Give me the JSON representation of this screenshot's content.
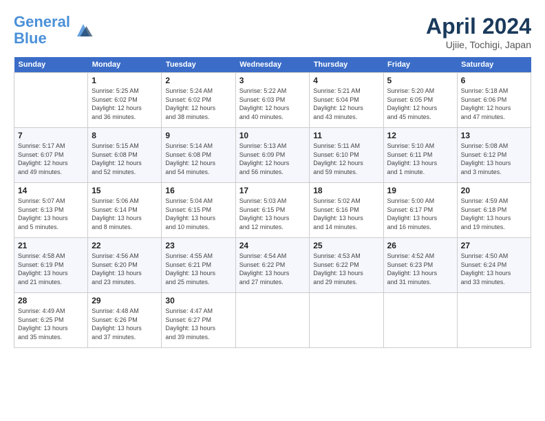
{
  "header": {
    "logo_line1": "General",
    "logo_line2": "Blue",
    "month_title": "April 2024",
    "location": "Ujiie, Tochigi, Japan"
  },
  "days_of_week": [
    "Sunday",
    "Monday",
    "Tuesday",
    "Wednesday",
    "Thursday",
    "Friday",
    "Saturday"
  ],
  "weeks": [
    [
      {
        "day": "",
        "info": ""
      },
      {
        "day": "1",
        "info": "Sunrise: 5:25 AM\nSunset: 6:02 PM\nDaylight: 12 hours\nand 36 minutes."
      },
      {
        "day": "2",
        "info": "Sunrise: 5:24 AM\nSunset: 6:02 PM\nDaylight: 12 hours\nand 38 minutes."
      },
      {
        "day": "3",
        "info": "Sunrise: 5:22 AM\nSunset: 6:03 PM\nDaylight: 12 hours\nand 40 minutes."
      },
      {
        "day": "4",
        "info": "Sunrise: 5:21 AM\nSunset: 6:04 PM\nDaylight: 12 hours\nand 43 minutes."
      },
      {
        "day": "5",
        "info": "Sunrise: 5:20 AM\nSunset: 6:05 PM\nDaylight: 12 hours\nand 45 minutes."
      },
      {
        "day": "6",
        "info": "Sunrise: 5:18 AM\nSunset: 6:06 PM\nDaylight: 12 hours\nand 47 minutes."
      }
    ],
    [
      {
        "day": "7",
        "info": "Sunrise: 5:17 AM\nSunset: 6:07 PM\nDaylight: 12 hours\nand 49 minutes."
      },
      {
        "day": "8",
        "info": "Sunrise: 5:15 AM\nSunset: 6:08 PM\nDaylight: 12 hours\nand 52 minutes."
      },
      {
        "day": "9",
        "info": "Sunrise: 5:14 AM\nSunset: 6:08 PM\nDaylight: 12 hours\nand 54 minutes."
      },
      {
        "day": "10",
        "info": "Sunrise: 5:13 AM\nSunset: 6:09 PM\nDaylight: 12 hours\nand 56 minutes."
      },
      {
        "day": "11",
        "info": "Sunrise: 5:11 AM\nSunset: 6:10 PM\nDaylight: 12 hours\nand 59 minutes."
      },
      {
        "day": "12",
        "info": "Sunrise: 5:10 AM\nSunset: 6:11 PM\nDaylight: 13 hours\nand 1 minute."
      },
      {
        "day": "13",
        "info": "Sunrise: 5:08 AM\nSunset: 6:12 PM\nDaylight: 13 hours\nand 3 minutes."
      }
    ],
    [
      {
        "day": "14",
        "info": "Sunrise: 5:07 AM\nSunset: 6:13 PM\nDaylight: 13 hours\nand 5 minutes."
      },
      {
        "day": "15",
        "info": "Sunrise: 5:06 AM\nSunset: 6:14 PM\nDaylight: 13 hours\nand 8 minutes."
      },
      {
        "day": "16",
        "info": "Sunrise: 5:04 AM\nSunset: 6:15 PM\nDaylight: 13 hours\nand 10 minutes."
      },
      {
        "day": "17",
        "info": "Sunrise: 5:03 AM\nSunset: 6:15 PM\nDaylight: 13 hours\nand 12 minutes."
      },
      {
        "day": "18",
        "info": "Sunrise: 5:02 AM\nSunset: 6:16 PM\nDaylight: 13 hours\nand 14 minutes."
      },
      {
        "day": "19",
        "info": "Sunrise: 5:00 AM\nSunset: 6:17 PM\nDaylight: 13 hours\nand 16 minutes."
      },
      {
        "day": "20",
        "info": "Sunrise: 4:59 AM\nSunset: 6:18 PM\nDaylight: 13 hours\nand 19 minutes."
      }
    ],
    [
      {
        "day": "21",
        "info": "Sunrise: 4:58 AM\nSunset: 6:19 PM\nDaylight: 13 hours\nand 21 minutes."
      },
      {
        "day": "22",
        "info": "Sunrise: 4:56 AM\nSunset: 6:20 PM\nDaylight: 13 hours\nand 23 minutes."
      },
      {
        "day": "23",
        "info": "Sunrise: 4:55 AM\nSunset: 6:21 PM\nDaylight: 13 hours\nand 25 minutes."
      },
      {
        "day": "24",
        "info": "Sunrise: 4:54 AM\nSunset: 6:22 PM\nDaylight: 13 hours\nand 27 minutes."
      },
      {
        "day": "25",
        "info": "Sunrise: 4:53 AM\nSunset: 6:22 PM\nDaylight: 13 hours\nand 29 minutes."
      },
      {
        "day": "26",
        "info": "Sunrise: 4:52 AM\nSunset: 6:23 PM\nDaylight: 13 hours\nand 31 minutes."
      },
      {
        "day": "27",
        "info": "Sunrise: 4:50 AM\nSunset: 6:24 PM\nDaylight: 13 hours\nand 33 minutes."
      }
    ],
    [
      {
        "day": "28",
        "info": "Sunrise: 4:49 AM\nSunset: 6:25 PM\nDaylight: 13 hours\nand 35 minutes."
      },
      {
        "day": "29",
        "info": "Sunrise: 4:48 AM\nSunset: 6:26 PM\nDaylight: 13 hours\nand 37 minutes."
      },
      {
        "day": "30",
        "info": "Sunrise: 4:47 AM\nSunset: 6:27 PM\nDaylight: 13 hours\nand 39 minutes."
      },
      {
        "day": "",
        "info": ""
      },
      {
        "day": "",
        "info": ""
      },
      {
        "day": "",
        "info": ""
      },
      {
        "day": "",
        "info": ""
      }
    ]
  ]
}
